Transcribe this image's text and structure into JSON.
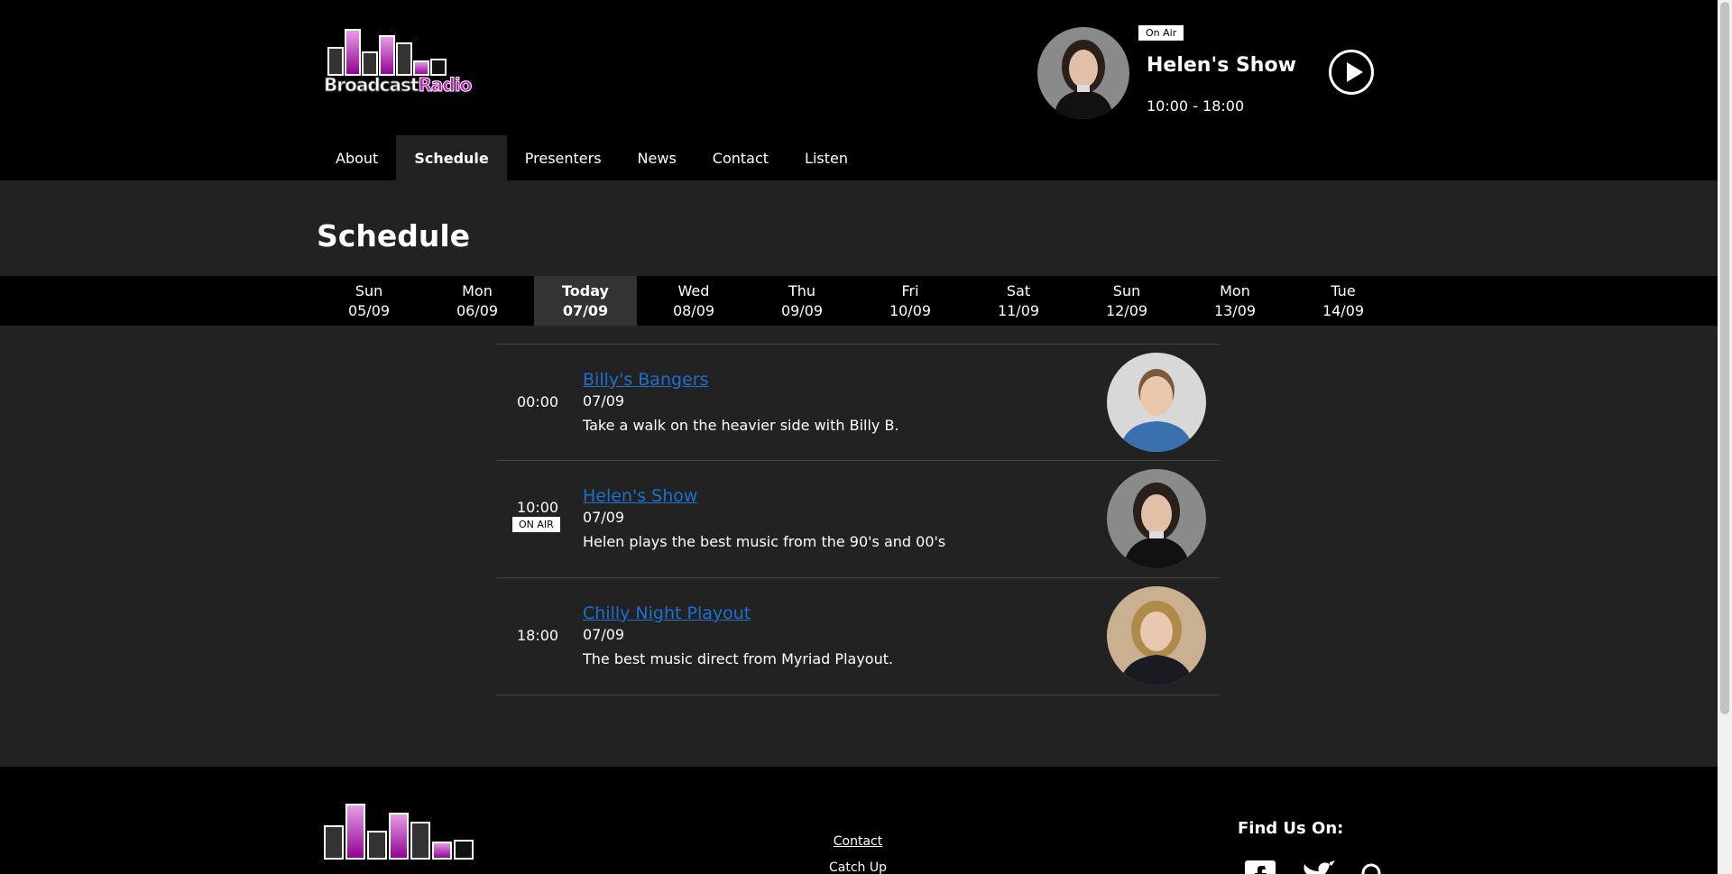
{
  "logo": {
    "text_white": "Broadcast",
    "text_pink": "Radio"
  },
  "nav": [
    {
      "label": "About",
      "active": false
    },
    {
      "label": "Schedule",
      "active": true
    },
    {
      "label": "Presenters",
      "active": false
    },
    {
      "label": "News",
      "active": false
    },
    {
      "label": "Contact",
      "active": false
    },
    {
      "label": "Listen",
      "active": false
    }
  ],
  "now_playing": {
    "badge": "On Air",
    "title": "Helen's Show",
    "time": "10:00 - 18:00"
  },
  "page_title": "Schedule",
  "days": [
    {
      "name": "Sun",
      "date": "05/09"
    },
    {
      "name": "Mon",
      "date": "06/09"
    },
    {
      "name": "Today",
      "date": "07/09",
      "active": true
    },
    {
      "name": "Wed",
      "date": "08/09"
    },
    {
      "name": "Thu",
      "date": "09/09"
    },
    {
      "name": "Fri",
      "date": "10/09"
    },
    {
      "name": "Sat",
      "date": "11/09"
    },
    {
      "name": "Sun",
      "date": "12/09"
    },
    {
      "name": "Mon",
      "date": "13/09"
    },
    {
      "name": "Tue",
      "date": "14/09"
    }
  ],
  "schedule": [
    {
      "time": "00:00",
      "title": "Billy's Bangers",
      "date": "07/09",
      "desc": "Take a walk on the heavier side with Billy B."
    },
    {
      "time": "10:00",
      "onair": "ON AIR",
      "title": "Helen's Show",
      "date": "07/09",
      "desc": "Helen plays the best music from the 90's and 00's"
    },
    {
      "time": "18:00",
      "title": "Chilly Night Playout",
      "date": "07/09",
      "desc": "The best music direct from Myriad Playout."
    }
  ],
  "footer": {
    "links": [
      "Contact",
      "Catch Up"
    ],
    "find_us": "Find Us On:"
  },
  "colors": {
    "brand_pink": "#c020c0",
    "link_blue": "#1e6fd0",
    "bg_dark": "#222222"
  }
}
